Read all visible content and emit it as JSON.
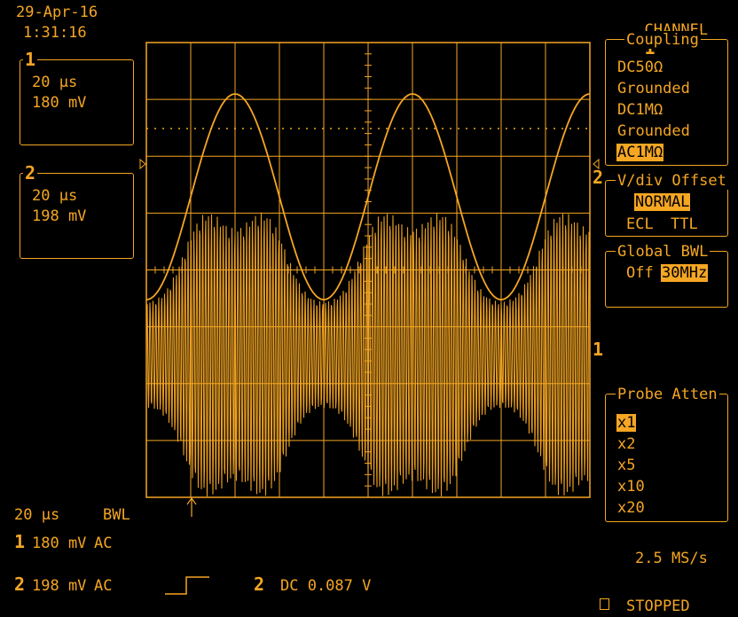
{
  "header": {
    "date": "29-Apr-16",
    "time": "1:31:16"
  },
  "channel_title": {
    "label": "CHANNEL",
    "number": "1"
  },
  "trace_boxes": [
    {
      "id": "1",
      "timebase": "20 µs",
      "volts": "180 mV"
    },
    {
      "id": "2",
      "timebase": "20 µs",
      "volts": "198 mV"
    }
  ],
  "menus": {
    "coupling": {
      "title": "Coupling",
      "options": [
        "DC50Ω",
        "Grounded",
        "DC1MΩ",
        "Grounded",
        "AC1MΩ"
      ],
      "selected": "AC1MΩ"
    },
    "vdiv_offset": {
      "title": "V/div Offset",
      "options": [
        "NORMAL",
        "ECL",
        "TTL"
      ],
      "selected": "NORMAL"
    },
    "global_bwl": {
      "title": "Global BWL",
      "options": [
        "Off",
        "30MHz"
      ],
      "selected": "30MHz"
    },
    "probe_atten": {
      "title": "Probe Atten",
      "options": [
        "x1",
        "x2",
        "x5",
        "x10",
        "x20"
      ],
      "selected": "x1"
    }
  },
  "markers": {
    "ch1": "1",
    "ch2": "2"
  },
  "footer": {
    "timebase": "20 µs",
    "bwl": "BWL",
    "ch1": {
      "id": "1",
      "volts": "180 mV",
      "coupling": "AC"
    },
    "ch2": {
      "id": "2",
      "volts": "198 mV",
      "coupling": "AC"
    },
    "trigger": {
      "id": "2",
      "info": "DC 0.087 V"
    },
    "sample_rate": "2.5 MS/s",
    "status": "STOPPED"
  },
  "colors": {
    "trace": "#f5a623",
    "background": "#000000"
  }
}
